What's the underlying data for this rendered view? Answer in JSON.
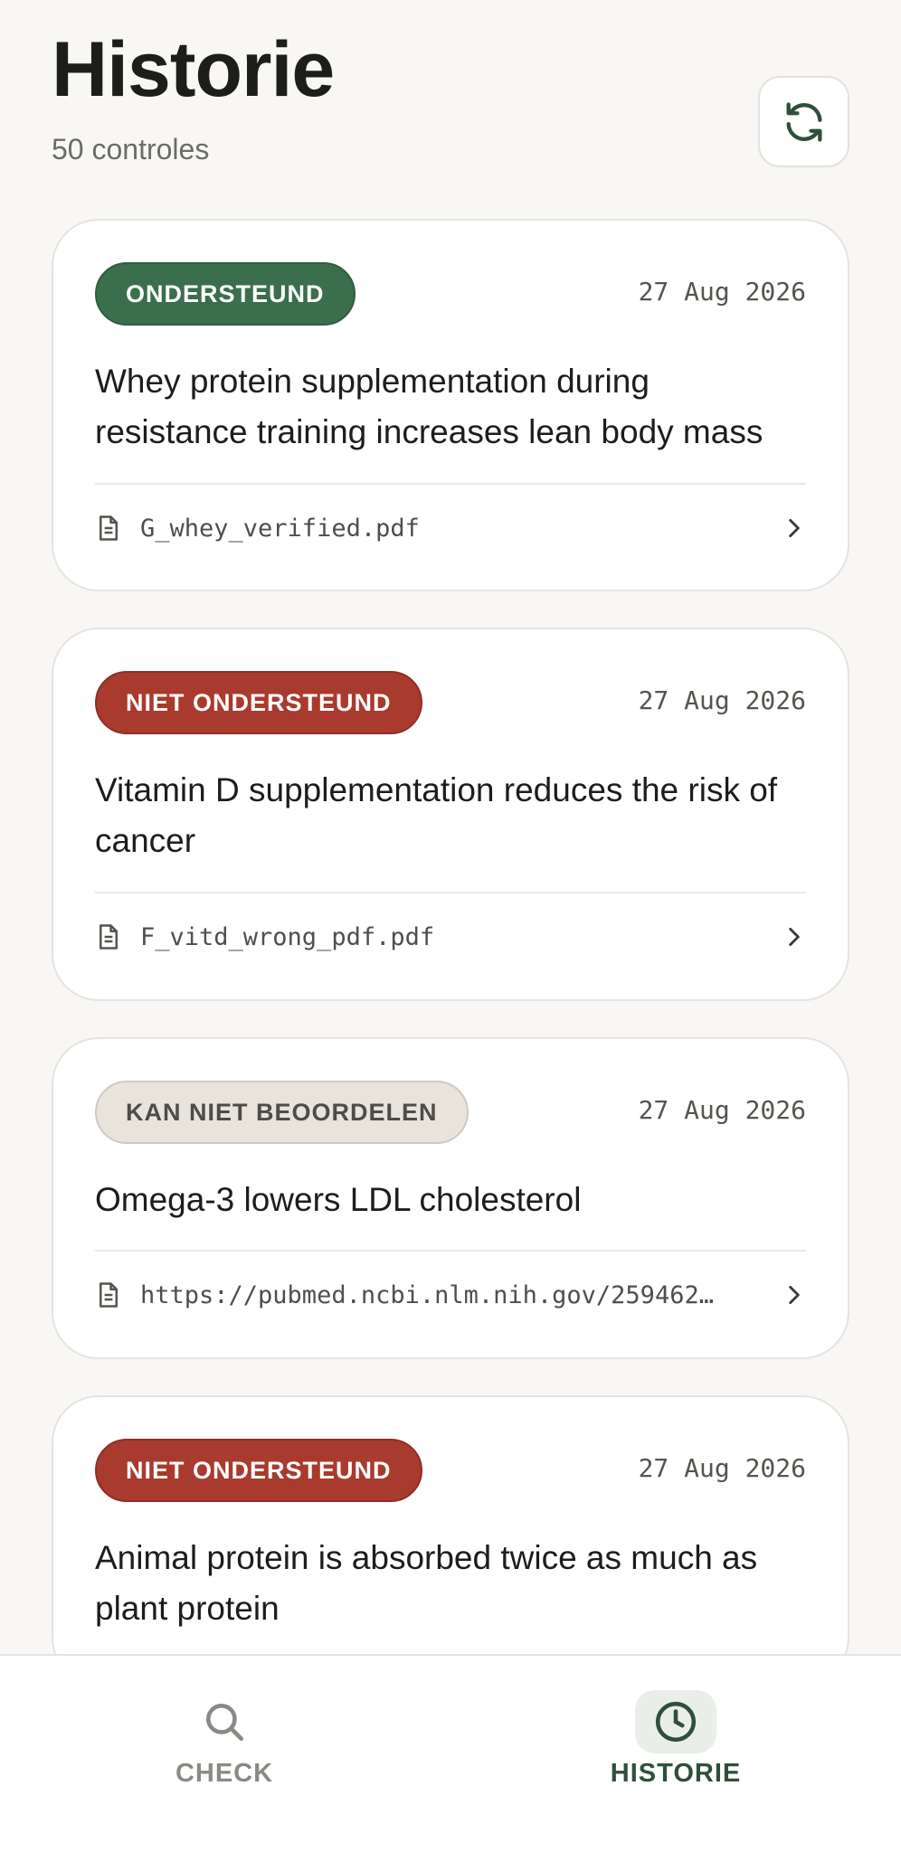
{
  "header": {
    "title": "Historie",
    "subtitle": "50 controles",
    "refresh_icon": "refresh-icon"
  },
  "cards": [
    {
      "badge": "ONDERSTEUND",
      "status": "supported",
      "date": "27 Aug 2026",
      "claim": "Whey protein supplementation during resistance training increases lean body mass",
      "source": "G_whey_verified.pdf"
    },
    {
      "badge": "NIET ONDERSTEUND",
      "status": "not-supported",
      "date": "27 Aug 2026",
      "claim": "Vitamin D supplementation reduces the risk of cancer",
      "source": "F_vitd_wrong_pdf.pdf"
    },
    {
      "badge": "KAN NIET BEOORDELEN",
      "status": "cannot-assess",
      "date": "27 Aug 2026",
      "claim": "Omega-3 lowers LDL cholesterol",
      "source": "https://pubmed.ncbi.nlm.nih.gov/259462…"
    },
    {
      "badge": "NIET ONDERSTEUND",
      "status": "not-supported",
      "date": "27 Aug 2026",
      "claim": "Animal protein is absorbed twice as much as plant protein"
    }
  ],
  "nav": {
    "check_label": "CHECK",
    "history_label": "HISTORIE",
    "active": "history"
  },
  "colors": {
    "supported": "#3a6e4d",
    "not_supported": "#a93a2e",
    "cannot_assess": "#e8e4dc",
    "accent": "#2f4f3a"
  }
}
